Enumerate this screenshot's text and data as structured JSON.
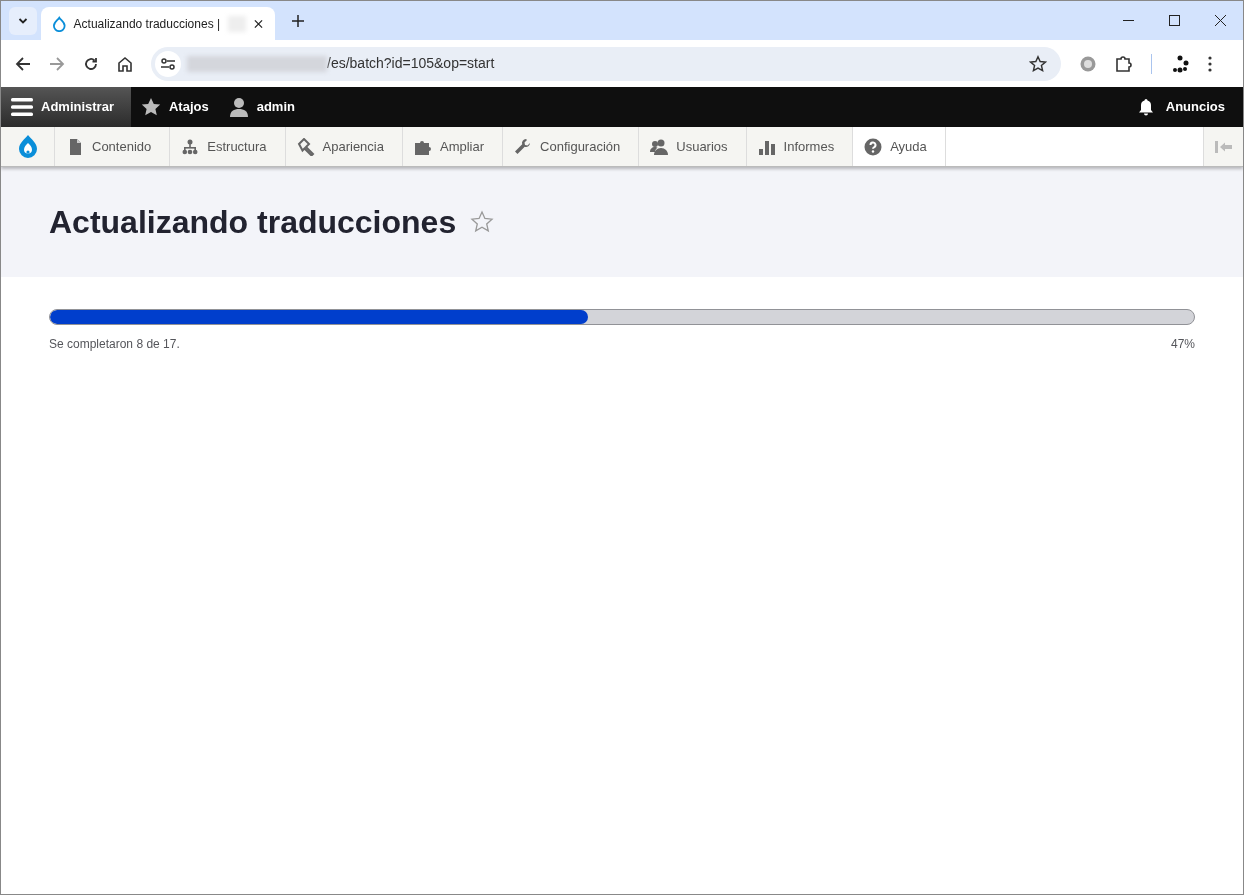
{
  "browser": {
    "tab_title": "Actualizando traducciones |",
    "address": "/es/batch?id=105&op=start"
  },
  "admin_bar": {
    "items": [
      {
        "kind": "menu",
        "label": "Administrar",
        "selected": true
      },
      {
        "kind": "star",
        "label": "Atajos",
        "selected": false
      },
      {
        "kind": "user",
        "label": "admin",
        "selected": false
      }
    ],
    "announcements": "Anuncios"
  },
  "admin_menu": [
    {
      "kind": "content",
      "label": "Contenido",
      "highlighted": false
    },
    {
      "kind": "structure",
      "label": "Estructura",
      "highlighted": false
    },
    {
      "kind": "appearance",
      "label": "Apariencia",
      "highlighted": false
    },
    {
      "kind": "extend",
      "label": "Ampliar",
      "highlighted": false
    },
    {
      "kind": "config",
      "label": "Configuración",
      "highlighted": false
    },
    {
      "kind": "people",
      "label": "Usuarios",
      "highlighted": false
    },
    {
      "kind": "reports",
      "label": "Informes",
      "highlighted": false
    },
    {
      "kind": "help",
      "label": "Ayuda",
      "highlighted": true
    }
  ],
  "page": {
    "title": "Actualizando traducciones",
    "favorite": false
  },
  "progress": {
    "level": 0.47,
    "message": "Se completaron 8 de 17.",
    "percent": "47%"
  }
}
